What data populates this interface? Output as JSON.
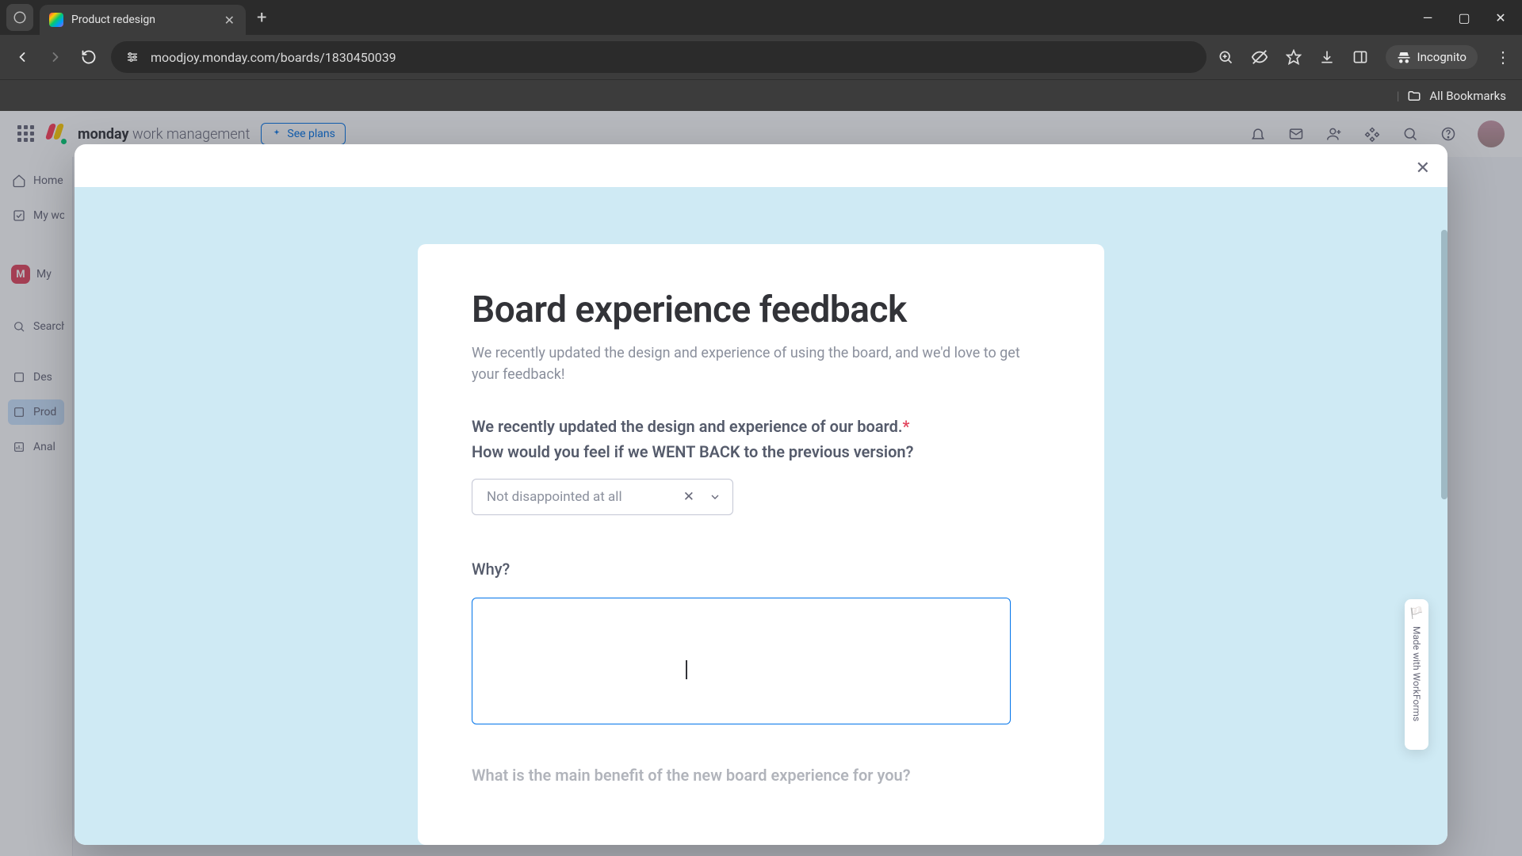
{
  "browser": {
    "tab_title": "Product redesign",
    "url": "moodjoy.monday.com/boards/1830450039",
    "incognito_label": "Incognito",
    "bookmarks_label": "All Bookmarks"
  },
  "monday": {
    "brand_bold": "monday",
    "brand_light": "work management",
    "see_plans": "See plans",
    "sidebar": {
      "home": "Home",
      "my_work": "My work",
      "workspace": "My",
      "search": "Search",
      "item_des": "Des",
      "item_prod": "Prod",
      "item_anal": "Anal"
    }
  },
  "form": {
    "title": "Board experience feedback",
    "subtitle": "We recently updated the design and experience of using the board, and we'd love to get your feedback!",
    "q1_line1": "We recently updated the design and experience of our board.",
    "q1_line2": "How would you feel if we WENT BACK to the previous version?",
    "q1_selected": "Not disappointed at all",
    "q2_label": "Why?",
    "q2_value": "",
    "q3_peek": "What is the main benefit of the new board experience for you?"
  },
  "badge": {
    "text": "Made with WorkForms"
  }
}
